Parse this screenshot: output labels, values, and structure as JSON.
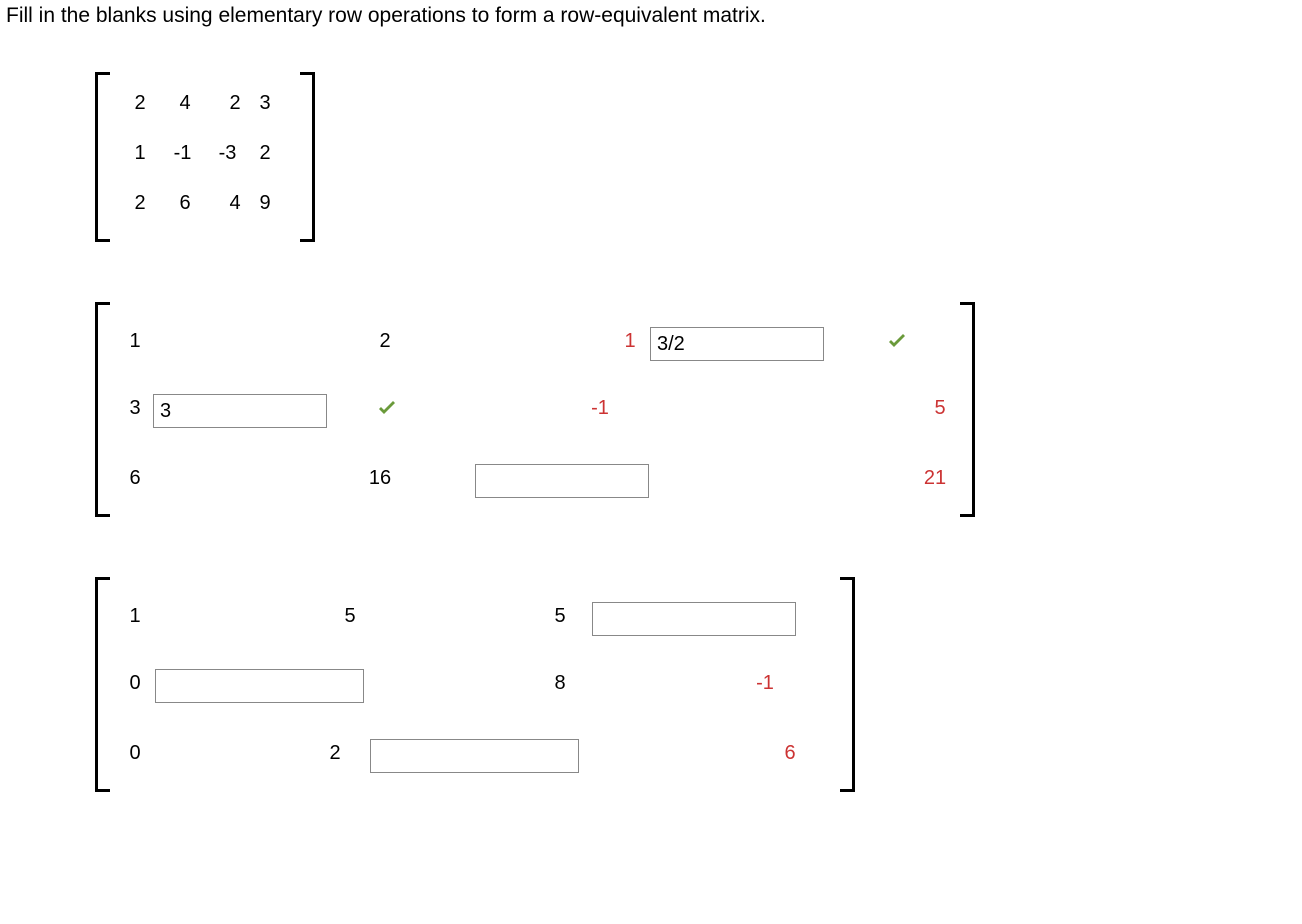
{
  "instruction": "Fill in the blanks using elementary row operations to form a row-equivalent matrix.",
  "matrix1": {
    "r1c1": "2",
    "r1c2": "4",
    "r1c3": "2",
    "r1c4": "3",
    "r2c1": "1",
    "r2c2": "-1",
    "r2c3": "-3",
    "r2c4": "2",
    "r3c1": "2",
    "r3c2": "6",
    "r3c3": "4",
    "r3c4": "9"
  },
  "matrix2": {
    "r1c1": "1",
    "r1c2": "2",
    "r1c3": "1",
    "r1c4_input": "3/2",
    "r2c1": "3",
    "r2c2_input": "3",
    "r2c3": "-1",
    "r2c4": "5",
    "r3c1": "6",
    "r3c2": "16",
    "r3c3_input": "",
    "r3c4": "21"
  },
  "matrix3": {
    "r1c1": "1",
    "r1c2": "5",
    "r1c3": "5",
    "r1c4_input": "",
    "r2c1": "0",
    "r2c2_input": "",
    "r2c3": "8",
    "r2c4": "-1",
    "r3c1": "0",
    "r3c2": "2",
    "r3c3_input": "",
    "r3c4": "6"
  }
}
